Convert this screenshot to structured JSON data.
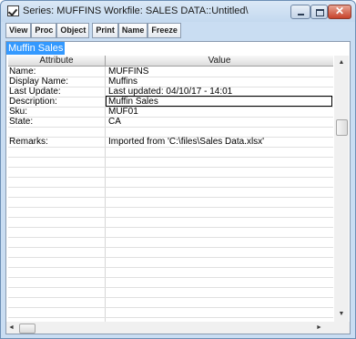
{
  "window": {
    "title": "Series: MUFFINS   Workfile: SALES DATA::Untitled\\",
    "minimize_glyph": "",
    "close_glyph": "✕"
  },
  "toolbar": {
    "view": "View",
    "proc": "Proc",
    "object": "Object",
    "print": "Print",
    "name": "Name",
    "freeze": "Freeze"
  },
  "name_bar": {
    "text": "Muffin Sales"
  },
  "table": {
    "headers": {
      "attribute": "Attribute",
      "value": "Value"
    },
    "rows": [
      {
        "attribute": "Name:",
        "value": "MUFFINS"
      },
      {
        "attribute": "Display Name:",
        "value": "Muffins"
      },
      {
        "attribute": "Last Update:",
        "value": "Last updated: 04/10/17 - 14:01"
      },
      {
        "attribute": "Description:",
        "value": "Muffin Sales"
      },
      {
        "attribute": "Sku:",
        "value": "MUF01"
      },
      {
        "attribute": "State:",
        "value": "CA"
      },
      {
        "attribute": "",
        "value": ""
      },
      {
        "attribute": "Remarks:",
        "value": "Imported from 'C:\\files\\Sales Data.xlsx'"
      }
    ]
  },
  "scroll": {
    "up": "▲",
    "down": "▼",
    "left": "◄",
    "right": "►"
  },
  "colors": {
    "selection": "#3399ff",
    "titlebar": "#c4d9ef",
    "close": "#c7432c"
  }
}
